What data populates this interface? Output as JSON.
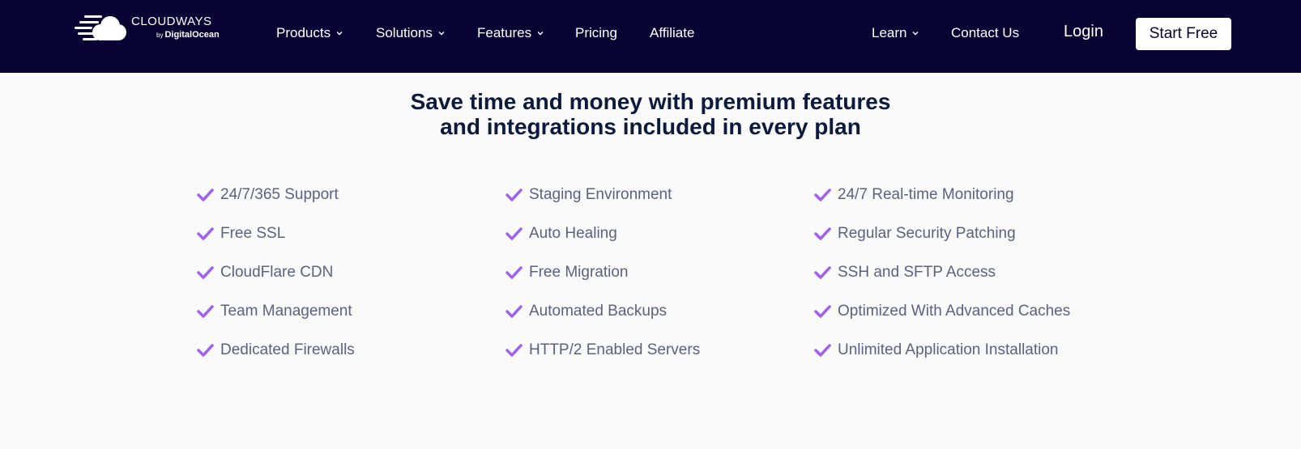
{
  "brand": {
    "name": "CLOUDWAYS",
    "by": "by",
    "company": "DigitalOcean"
  },
  "nav": {
    "products": "Products",
    "solutions": "Solutions",
    "features": "Features",
    "pricing": "Pricing",
    "affiliate": "Affiliate",
    "learn": "Learn",
    "contact": "Contact Us",
    "login": "Login",
    "start_free": "Start Free"
  },
  "headline": {
    "line1": "Save time and money with premium features",
    "line2": "and integrations included in every plan"
  },
  "features": {
    "col1": [
      "24/7/365 Support",
      "Free SSL",
      "CloudFlare CDN",
      "Team Management",
      "Dedicated Firewalls"
    ],
    "col2": [
      "Staging Environment",
      "Auto Healing",
      "Free Migration",
      "Automated Backups",
      "HTTP/2 Enabled Servers"
    ],
    "col3": [
      "24/7 Real-time Monitoring",
      "Regular Security Patching",
      "SSH and SFTP Access",
      "Optimized With Advanced Caches",
      "Unlimited Application Installation"
    ]
  },
  "colors": {
    "nav_bg": "#070332",
    "check": "#9b63f0",
    "headline": "#0b1a3d",
    "feature_text": "#5a6280"
  },
  "icons": {
    "logo": "cloud-logo-icon",
    "dropdown": "chevron-down-icon",
    "check": "check-icon"
  }
}
